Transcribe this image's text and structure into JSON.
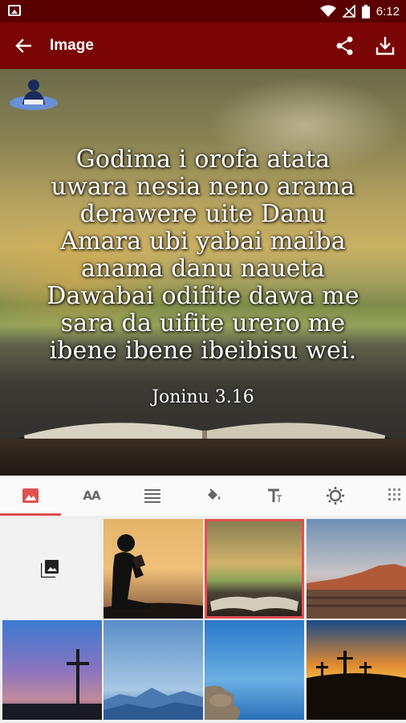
{
  "status_bar": {
    "time": "6:12",
    "icons": [
      "image-notification-icon",
      "wifi-icon",
      "no-signal-icon",
      "battery-icon"
    ]
  },
  "app_bar": {
    "title": "Image",
    "back_icon": "arrow-back-icon",
    "actions": [
      "share-icon",
      "download-icon"
    ]
  },
  "preview": {
    "verse_lines": [
      "Godima i orofa atata",
      "uwara nesia neno arama",
      "derawere uite Danu",
      "Amara ubi yabai maiba",
      "anama danu naueta",
      "Dawabai odifite dawa me",
      "sara da uifite urero me",
      "ibene ibene ibeibisu wei."
    ],
    "reference": "Joninu 3.16"
  },
  "tabs": [
    {
      "icon": "image-icon",
      "active": true
    },
    {
      "icon": "text-size-icon",
      "label": "AA",
      "active": false
    },
    {
      "icon": "align-icon",
      "active": false
    },
    {
      "icon": "fill-color-icon",
      "active": false
    },
    {
      "icon": "text-format-icon",
      "active": false
    },
    {
      "icon": "brightness-icon",
      "active": false
    },
    {
      "icon": "texture-icon",
      "active": false
    }
  ],
  "backgrounds": [
    {
      "name": "gallery-picker",
      "icon": "photo-library-icon"
    },
    {
      "name": "reading-child-sunset"
    },
    {
      "name": "open-bible-bokeh",
      "selected": true
    },
    {
      "name": "desert-mountains"
    },
    {
      "name": "cross-purple-sky"
    },
    {
      "name": "blue-mountains"
    },
    {
      "name": "rocky-coast-sea"
    },
    {
      "name": "three-crosses-sunset"
    }
  ],
  "colors": {
    "status_bar": "#5a0000",
    "app_bar": "#7a0505",
    "accent": "#e05050"
  }
}
